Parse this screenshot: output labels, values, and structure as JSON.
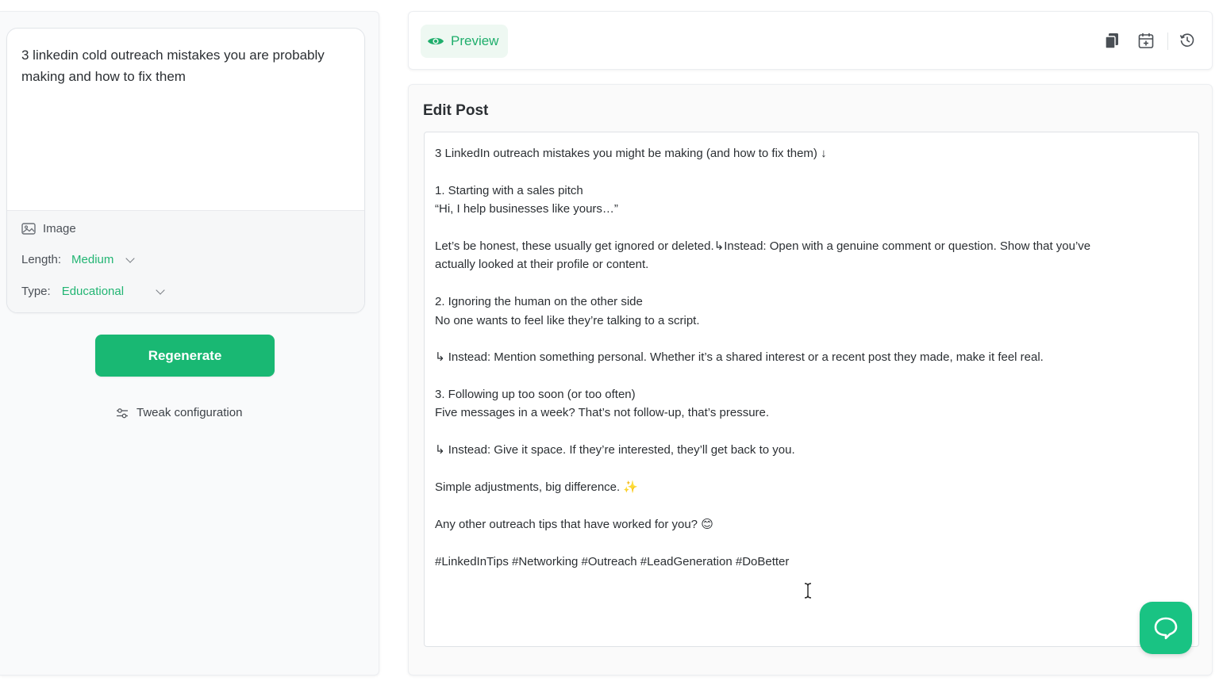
{
  "prompt": {
    "text": "3 linkedin cold outreach mistakes you are probably making and how to fix them"
  },
  "options": {
    "image_label": "Image",
    "length_label": "Length:",
    "length_value": "Medium",
    "type_label": "Type:",
    "type_value": "Educational"
  },
  "actions": {
    "regenerate_label": "Regenerate",
    "tweak_label": "Tweak configuration"
  },
  "topbar": {
    "preview_label": "Preview",
    "icons": [
      "copy-icon",
      "calendar-add-icon",
      "history-icon"
    ]
  },
  "editor": {
    "title": "Edit Post",
    "lines": [
      "3 LinkedIn outreach mistakes you might be making (and how to fix them) ↓",
      "",
      "1. Starting with a sales pitch",
      "“Hi, I help businesses like yours…”",
      "",
      "Let’s be honest, these usually get ignored or deleted.↳Instead: Open with a genuine comment or question. Show that you’ve",
      "actually looked at their profile or content.",
      "",
      "2. Ignoring the human on the other side",
      "No one wants to feel like they’re talking to a script.",
      "",
      "↳ Instead: Mention something personal. Whether it’s a shared interest or a recent post they made, make it feel real.",
      "",
      "3. Following up too soon (or too often)",
      "Five messages in a week? That’s not follow-up, that’s pressure.",
      "",
      "↳ Instead: Give it space. If they’re interested, they’ll get back to you.",
      "",
      "Simple adjustments, big difference. ✨",
      "",
      "Any other outreach tips that have worked for you? 😊",
      "",
      "#LinkedInTips #Networking #Outreach #LeadGeneration #DoBetter"
    ]
  },
  "colors": {
    "accent": "#19b873",
    "accent_text": "#22b573",
    "preview_bg": "#eef8f2",
    "help_button": "#19c383"
  }
}
